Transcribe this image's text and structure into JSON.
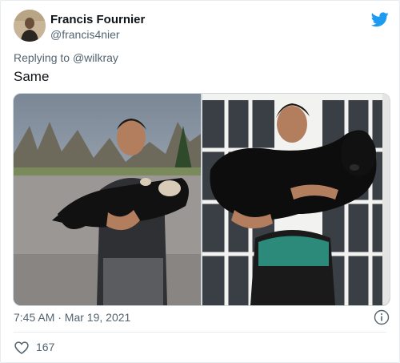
{
  "author": {
    "name": "Francis Fournier",
    "handle": "@francis4nier"
  },
  "brand": {
    "icon": "twitter-bird-icon",
    "color": "#1d9bf0"
  },
  "reply": {
    "prefix": "Replying to",
    "mention": "@wilkray"
  },
  "tweet": {
    "text": "Same",
    "timestamp": "7:45 AM · Mar 19, 2021"
  },
  "media": [
    {
      "description": "photo-man-holding-black-puppy-outdoors"
    },
    {
      "description": "photo-man-holding-large-black-poodle-indoors"
    }
  ],
  "engagement": {
    "like_icon": "heart-icon",
    "like_count": "167",
    "info_icon": "info-icon"
  }
}
